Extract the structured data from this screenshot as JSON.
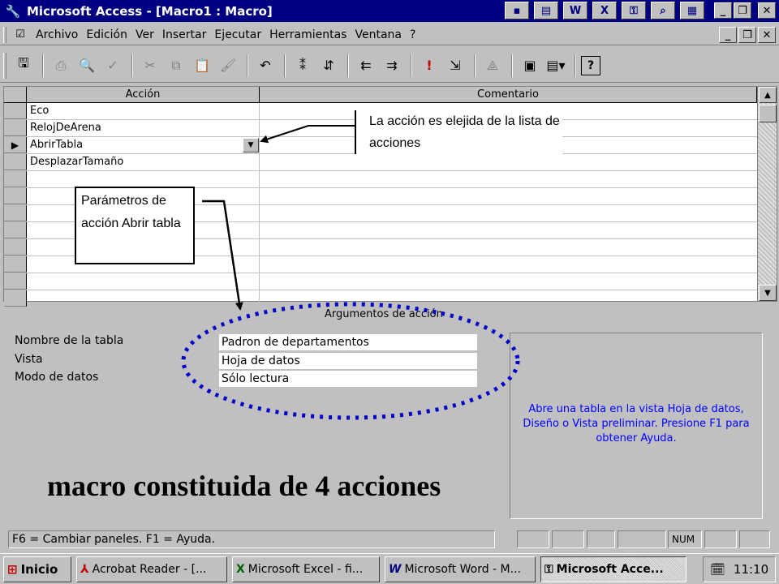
{
  "window": {
    "title": "Microsoft Access - [Macro1 : Macro]",
    "app_icon": "key-icon",
    "title_icons": [
      "access-icon",
      "document-icon",
      "word-icon",
      "excel-icon",
      "key-icon",
      "search-icon",
      "image-icon"
    ]
  },
  "menu": {
    "items": [
      "Archivo",
      "Edición",
      "Ver",
      "Insertar",
      "Ejecutar",
      "Herramientas",
      "Ventana",
      "?"
    ]
  },
  "grid": {
    "headers": {
      "accion": "Acción",
      "comentario": "Comentario"
    },
    "rows": [
      "Eco",
      "RelojDeArena",
      "AbrirTabla",
      "DesplazarTamaño"
    ],
    "current_row_index": 2
  },
  "callouts": {
    "action_list": "La acción es elejida de la lista de acciones",
    "params": "Parámetros de acción Abrir tabla"
  },
  "arguments": {
    "section_label": "Argumentos de acción",
    "fields": [
      {
        "label": "Nombre de la tabla",
        "value": "Padron de departamentos"
      },
      {
        "label": "Vista",
        "value": "Hoja de datos"
      },
      {
        "label": "Modo de datos",
        "value": "Sólo lectura"
      }
    ],
    "help_text": "Abre una tabla en la vista Hoja de datos, Diseño o Vista preliminar. Presione F1 para obtener Ayuda."
  },
  "caption": "macro constituida de 4 acciones",
  "status": {
    "text": "F6 = Cambiar paneles.  F1 = Ayuda.",
    "num_indicator": "NUM"
  },
  "taskbar": {
    "start_label": "Inicio",
    "tasks": [
      {
        "label": "Acrobat Reader - [...",
        "icon": "acrobat-icon"
      },
      {
        "label": "Microsoft Excel - fi...",
        "icon": "excel-icon"
      },
      {
        "label": "Microsoft Word - M...",
        "icon": "word-icon"
      },
      {
        "label": "Microsoft Acce...",
        "icon": "access-icon",
        "active": true
      }
    ],
    "clock": "11:10"
  },
  "colors": {
    "title_bar": "#000080",
    "face": "#c0c0c0",
    "help_text": "#0000ff",
    "highlight_ellipse": "#0000cc"
  }
}
